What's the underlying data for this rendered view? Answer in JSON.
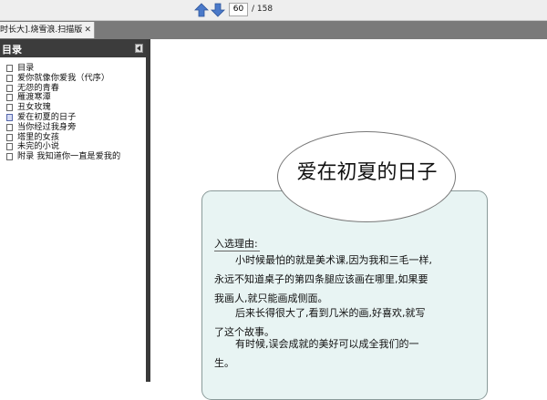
{
  "toolbar": {
    "prev_icon": "arrow-up-icon",
    "next_icon": "arrow-down-icon",
    "current_page": "60",
    "total_pages": "/ 158"
  },
  "tab": {
    "title": "时长大].烧雪浪.扫描版",
    "close": "✕"
  },
  "outline": {
    "title": "目录",
    "items": [
      {
        "label": "目录"
      },
      {
        "label": "爱你就像你爱我（代序）"
      },
      {
        "label": "无怨的青春"
      },
      {
        "label": "雁渡寒潭"
      },
      {
        "label": "丑女玫瑰"
      },
      {
        "label": "爱在初夏的日子"
      },
      {
        "label": "当你经过我身旁"
      },
      {
        "label": "塔里的女孩"
      },
      {
        "label": "未完的小说"
      },
      {
        "label": "附录   我知道你一直是爱我的"
      }
    ],
    "current_index": 5
  },
  "page": {
    "chapter_title": "爱在初夏的日子",
    "reason_label": "入选理由:",
    "paragraphs": [
      "小时候最怕的就是美术课,因为我和三毛一样,永远不知道桌子的第四条腿应该画在哪里,如果要我画人,就只能画成侧面。",
      "后来长得很大了,看到几米的画,好喜欢,就写了这个故事。",
      "有时候,误会成就的美好可以成全我们的一生。"
    ]
  },
  "colors": {
    "toolbar_bg": "#eeeeee",
    "panel_header": "#3c3c3c",
    "callout_bg": "#e8f4f3",
    "nav_blue": "#4a79c9"
  }
}
